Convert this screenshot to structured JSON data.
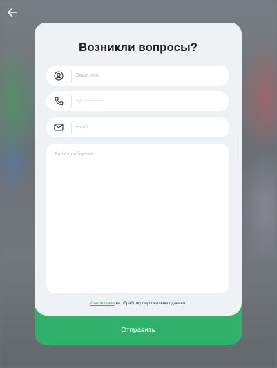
{
  "modal": {
    "title": "Возникли вопросы?",
    "fields": {
      "name_placeholder": "Ваше имя",
      "phone_placeholder": "+7 --- --- -- --",
      "email_placeholder": "email"
    },
    "message_placeholder": "Ваше сообщение",
    "consent": {
      "link_text": "Соглашение",
      "rest_text": "на обработку персональных данных"
    },
    "submit_label": "Отправить"
  },
  "icons": {
    "back": "arrow-left-icon",
    "name": "user-icon",
    "phone": "phone-icon",
    "email": "mail-icon"
  },
  "colors": {
    "accent": "#2fb16c",
    "panel": "#eef2f5"
  }
}
